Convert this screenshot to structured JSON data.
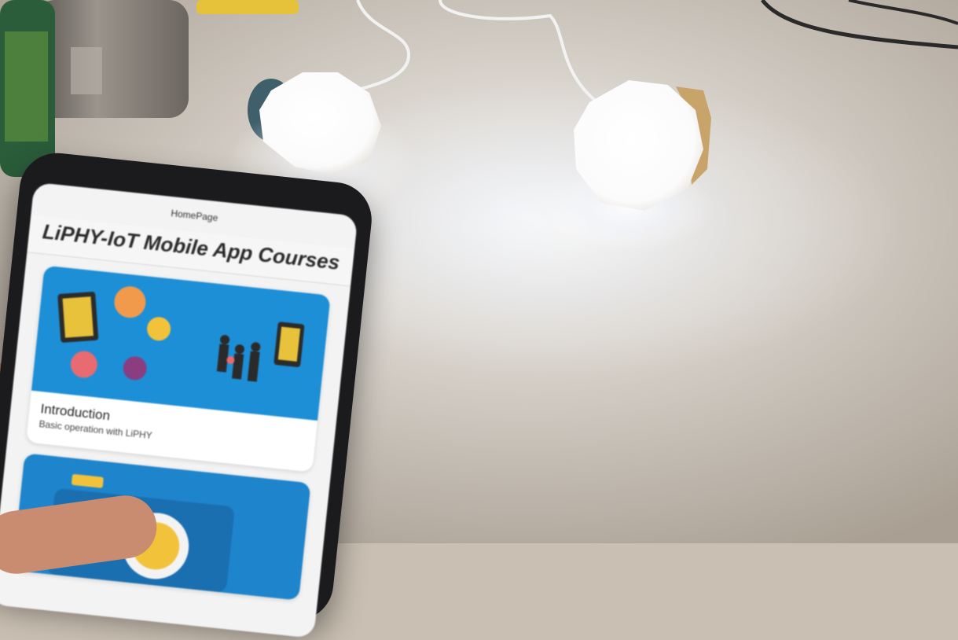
{
  "app": {
    "header_label": "HomePage",
    "title": "LiPHY-IoT Mobile App Courses",
    "cards": [
      {
        "title": "Introduction",
        "subtitle": "Basic operation with LiPHY"
      }
    ]
  },
  "colors": {
    "table": "#c9bfb2",
    "bulb_glow": "#ffffff",
    "card_blue": "#1d8fd6"
  }
}
